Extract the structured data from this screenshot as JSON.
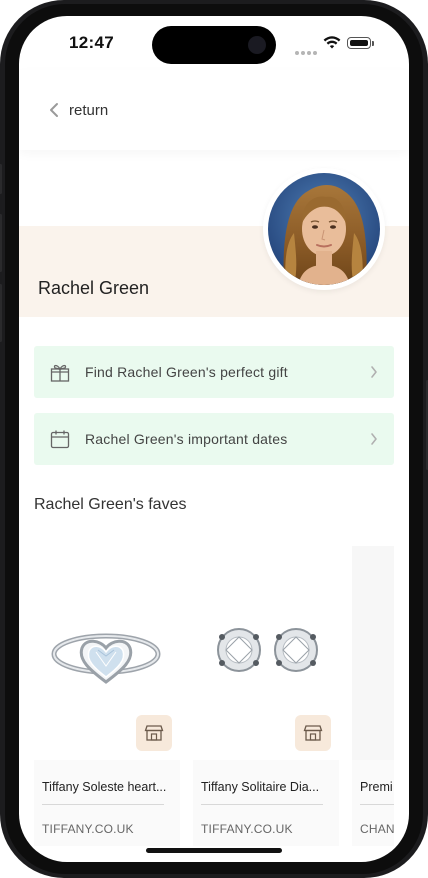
{
  "status_bar": {
    "time": "12:47"
  },
  "nav": {
    "back_label": "return"
  },
  "profile": {
    "name": "Rachel Green"
  },
  "actions": [
    {
      "label": "Find Rachel Green's perfect gift",
      "icon": "gift-icon"
    },
    {
      "label": "Rachel Green's important dates",
      "icon": "calendar-icon"
    }
  ],
  "faves": {
    "title": "Rachel Green's faves",
    "products": [
      {
        "name": "Tiffany Soleste heart...",
        "store": "TIFFANY.CO.UK",
        "image": "heart-ring-image"
      },
      {
        "name": "Tiffany Solitaire Dia...",
        "store": "TIFFANY.CO.UK",
        "image": "diamond-earrings-image"
      },
      {
        "name": "Premi",
        "store": "CHAN",
        "image": ""
      }
    ]
  },
  "colors": {
    "profile_band": "#faf3ec",
    "action_row": "#eafaef",
    "shop_button": "#f7e9db"
  }
}
